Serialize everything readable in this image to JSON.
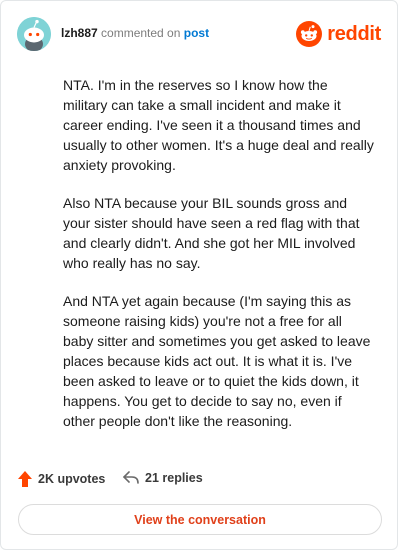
{
  "header": {
    "username": "lzh887",
    "commented_on": "commented on",
    "post_link": "post",
    "logo_text": "reddit"
  },
  "comment": {
    "paragraphs": [
      "NTA. I'm in the reserves so I know how the military can take a small incident and make it career ending. I've seen it a thousand times and usually to other women. It's a huge deal and really anxiety provoking.",
      "Also NTA because your BIL sounds gross and your sister should have seen a red flag with that and clearly didn't. And she got her MIL involved who really has no say.",
      "And NTA yet again because (I'm saying this as someone raising kids) you're not a free for all baby sitter and sometimes you get asked to leave places because kids act out. It is what it is. I've been asked to leave or to quiet the kids down, it happens. You get to decide to say no, even if other people don't like the reasoning."
    ]
  },
  "footer": {
    "upvotes": "2K upvotes",
    "replies": "21 replies",
    "upvote_icon": "upvote-arrow-icon",
    "reply_icon": "reply-arrow-icon"
  },
  "cta": {
    "label": "View the conversation"
  },
  "colors": {
    "brand": "#ff4500",
    "link": "#0079d3",
    "cta_text": "#e0401a",
    "avatar_bg": "#7fd3d6"
  }
}
